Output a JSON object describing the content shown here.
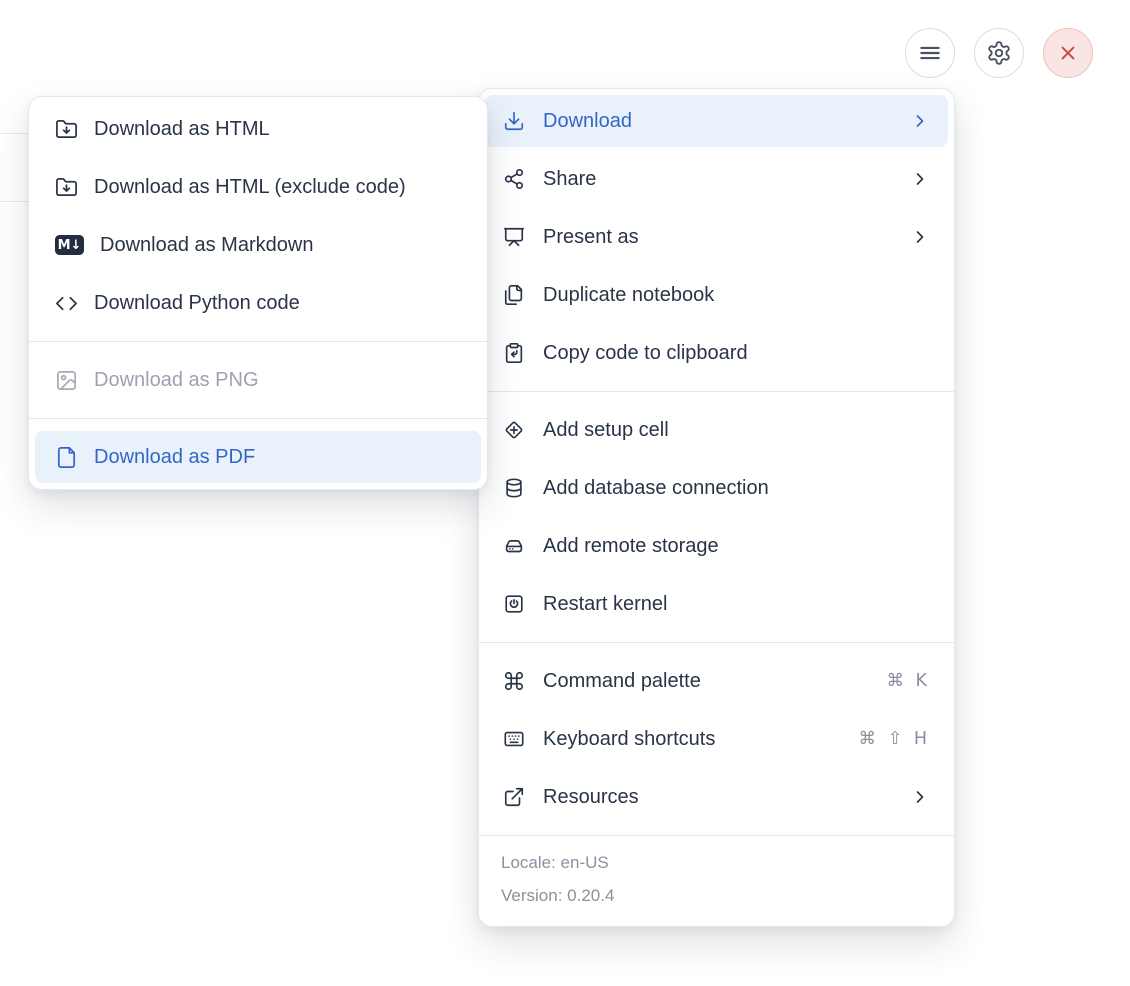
{
  "toolbar": {
    "buttons": [
      {
        "name": "menu"
      },
      {
        "name": "settings"
      },
      {
        "name": "close"
      }
    ]
  },
  "download_submenu": {
    "items": [
      {
        "label": "Download as HTML"
      },
      {
        "label": "Download as HTML (exclude code)"
      },
      {
        "label": "Download as Markdown",
        "badge": "M↓"
      },
      {
        "label": "Download Python code"
      },
      {
        "label": "Download as PNG",
        "state": "disabled"
      },
      {
        "label": "Download as PDF",
        "state": "active"
      }
    ]
  },
  "main_menu": {
    "items": {
      "download": "Download",
      "share": "Share",
      "present_as": "Present as",
      "duplicate_notebook": "Duplicate notebook",
      "copy_code": "Copy code to clipboard",
      "add_setup_cell": "Add setup cell",
      "add_database_connection": "Add database connection",
      "add_remote_storage": "Add remote storage",
      "restart_kernel": "Restart kernel",
      "command_palette": "Command palette",
      "keyboard_shortcuts": "Keyboard shortcuts",
      "resources": "Resources"
    },
    "shortcuts": {
      "command_palette": "⌘ K",
      "keyboard_shortcuts": "⌘ ⇧ H"
    },
    "footer": {
      "locale": "Locale: en-US",
      "version": "Version: 0.20.4"
    }
  },
  "colors": {
    "accent_blue": "#3566C6",
    "accent_blue_bg": "#E9F1FB",
    "text_dark": "#2A3447",
    "text_muted": "#8A919E",
    "shortcut_gray": "#878E9B",
    "disabled_gray": "#9CA3AF",
    "danger_red": "#CF4B46",
    "danger_bg": "#F9E6E4",
    "separator": "#E6E8EC"
  }
}
